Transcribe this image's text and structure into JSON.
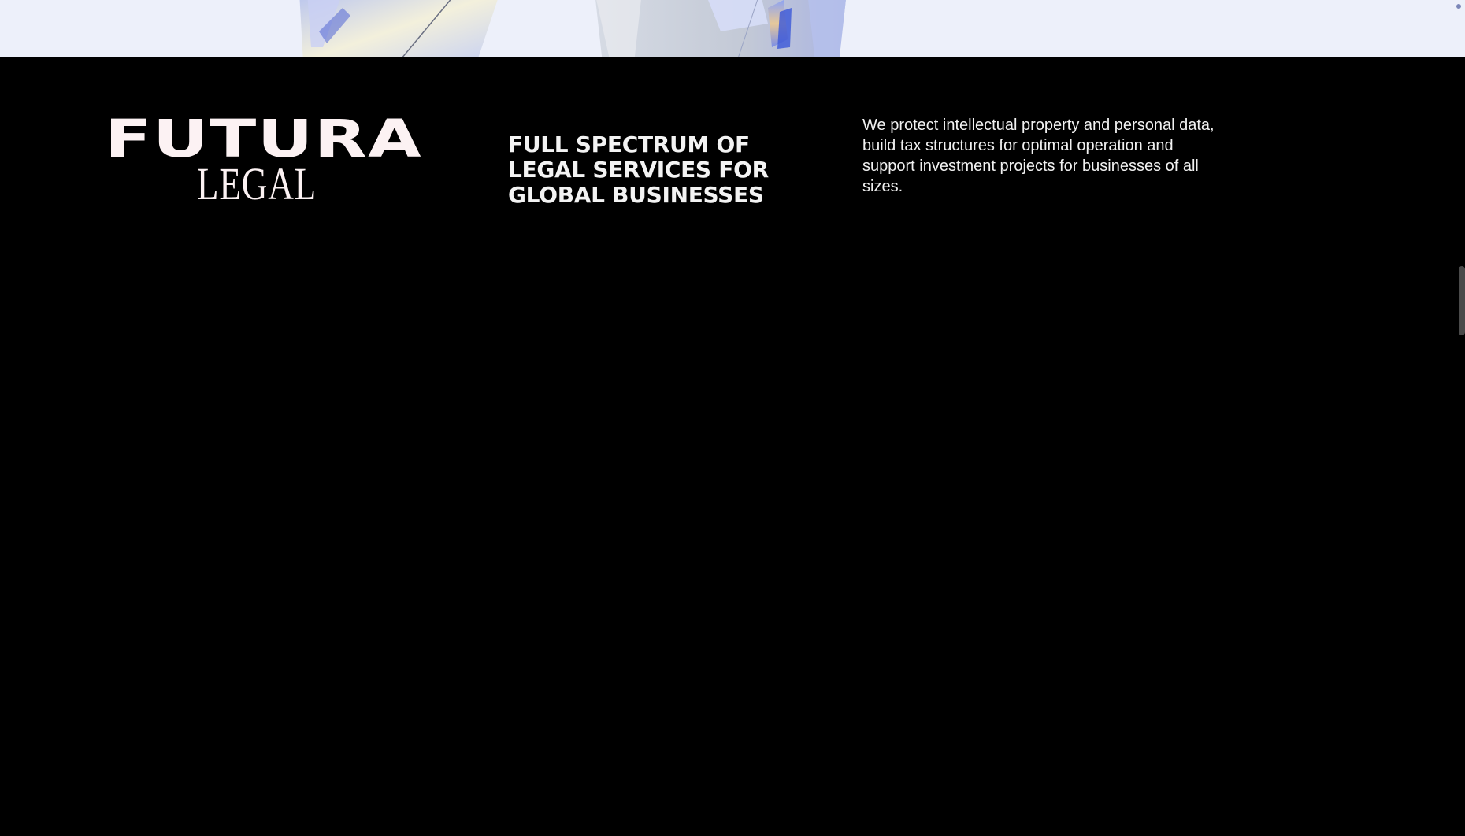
{
  "brand": {
    "logo_line1": "FUTURA",
    "logo_line2": "LEGAL",
    "text_color": "#fcf2f3"
  },
  "footer": {
    "tagline": "FULL SPECTRUM OF LEGAL SERVICES FOR GLOBAL BUSINESSES",
    "description": "We protect intellectual property and personal data, build tax structures for optimal operation and support investment projects for businesses of all sizes."
  },
  "hero": {
    "background_color": "#edf0fa",
    "art_icon": "glass-prism-3d-art"
  },
  "theme": {
    "page_background": "#000000"
  }
}
